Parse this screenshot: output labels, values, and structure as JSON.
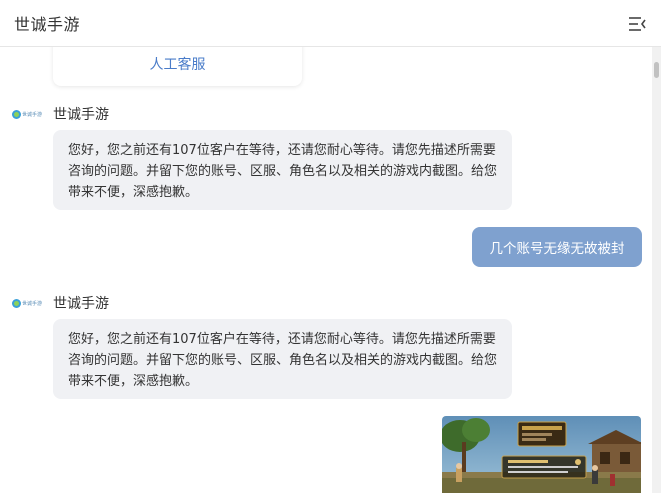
{
  "header": {
    "title": "世诚手游",
    "menu_icon": "collapse-menu-icon"
  },
  "chat": {
    "service_card": {
      "link_label": "人工客服"
    },
    "agent_logo_text": "世诚手游",
    "messages": [
      {
        "role": "agent",
        "name": "世诚手游",
        "text": "您好，您之前还有107位客户在等待，还请您耐心等待。请您先描述所需要咨询的问题。并留下您的账号、区服、角色名以及相关的游戏内截图。给您带来不便，深感抱歉。"
      },
      {
        "role": "user",
        "text": "几个账号无缘无故被封"
      },
      {
        "role": "agent",
        "name": "世诚手游",
        "text": "您好，您之前还有107位客户在等待，还请您耐心等待。请您先描述所需要咨询的问题。并留下您的账号、区服、角色名以及相关的游戏内截图。给您带来不便，深感抱歉。"
      },
      {
        "role": "user",
        "type": "image",
        "image_icon": "game-screenshot-image"
      }
    ]
  },
  "colors": {
    "agent_bubble": "#f0f1f4",
    "user_bubble": "#7fa1cf",
    "link": "#4a7cc9"
  }
}
